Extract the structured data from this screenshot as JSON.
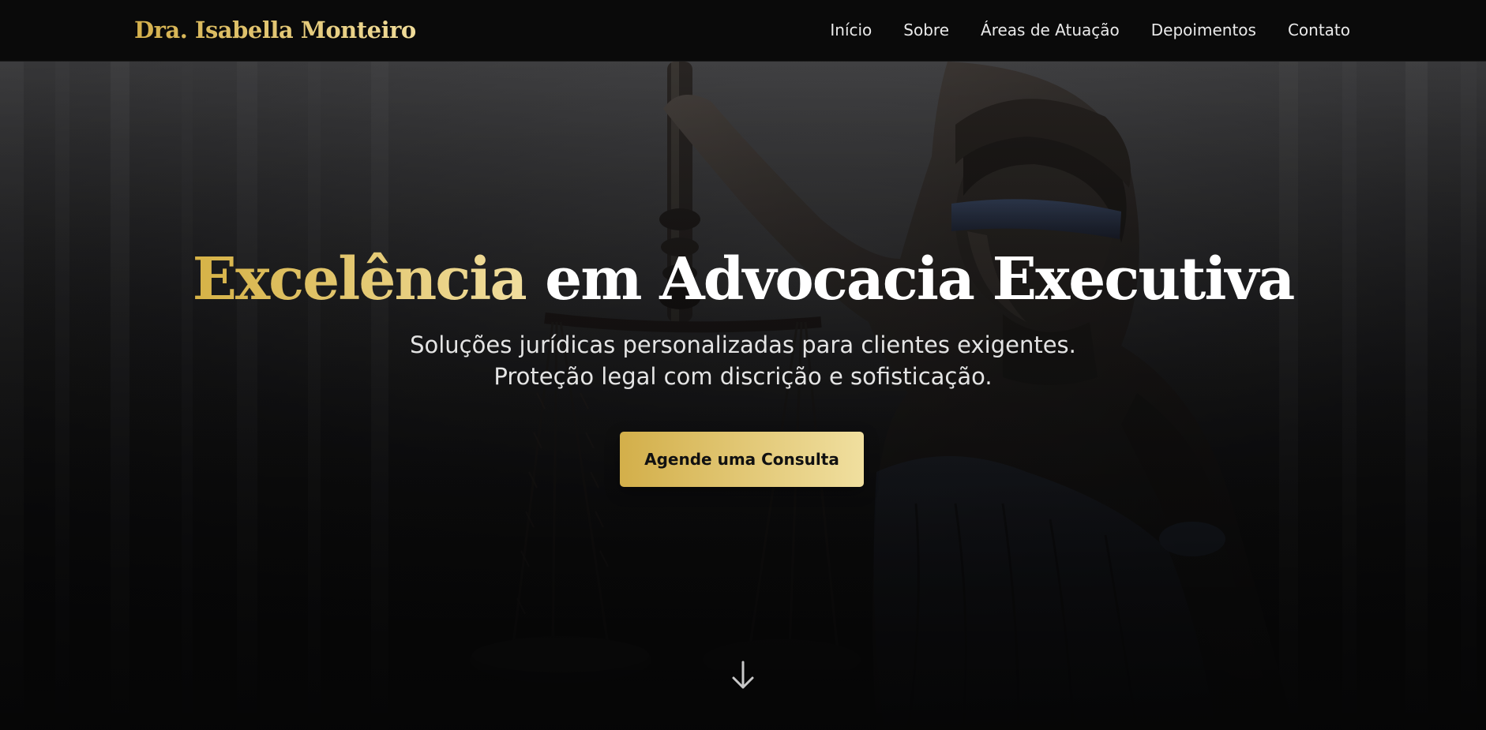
{
  "brand": {
    "name": "Dra. Isabella Monteiro"
  },
  "nav": {
    "items": [
      {
        "label": "Início"
      },
      {
        "label": "Sobre"
      },
      {
        "label": "Áreas de Atuação"
      },
      {
        "label": "Depoimentos"
      },
      {
        "label": "Contato"
      }
    ]
  },
  "hero": {
    "title_accent": "Excelência",
    "title_rest": " em Advocacia Executiva",
    "subtitle_line1": "Soluções jurídicas personalizadas para clientes exigentes.",
    "subtitle_line2": "Proteção legal com discrição e sofisticação.",
    "cta_label": "Agende uma Consulta",
    "background_image": "lady-justice-statue-photo",
    "scroll_icon": "arrow-down-icon"
  },
  "colors": {
    "gold_start": "#d4b04c",
    "gold_end": "#f0dc9a",
    "nav_background": "#0a0a0a",
    "text_light": "#eaeaea"
  }
}
